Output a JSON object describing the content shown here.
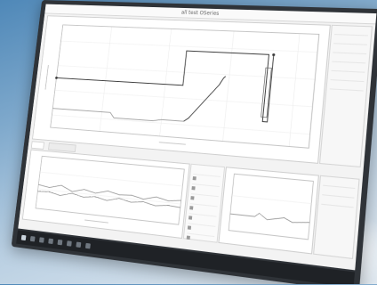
{
  "window": {
    "title": "all test OSeries"
  },
  "colors": {
    "screen_bg": "#f3f3f3",
    "trace": "#3c3c3c",
    "taskbar": "#1f2226"
  },
  "icons": [
    "start-icon",
    "search-icon",
    "taskview-icon",
    "explorer-icon",
    "browser-icon",
    "app-icon"
  ]
}
